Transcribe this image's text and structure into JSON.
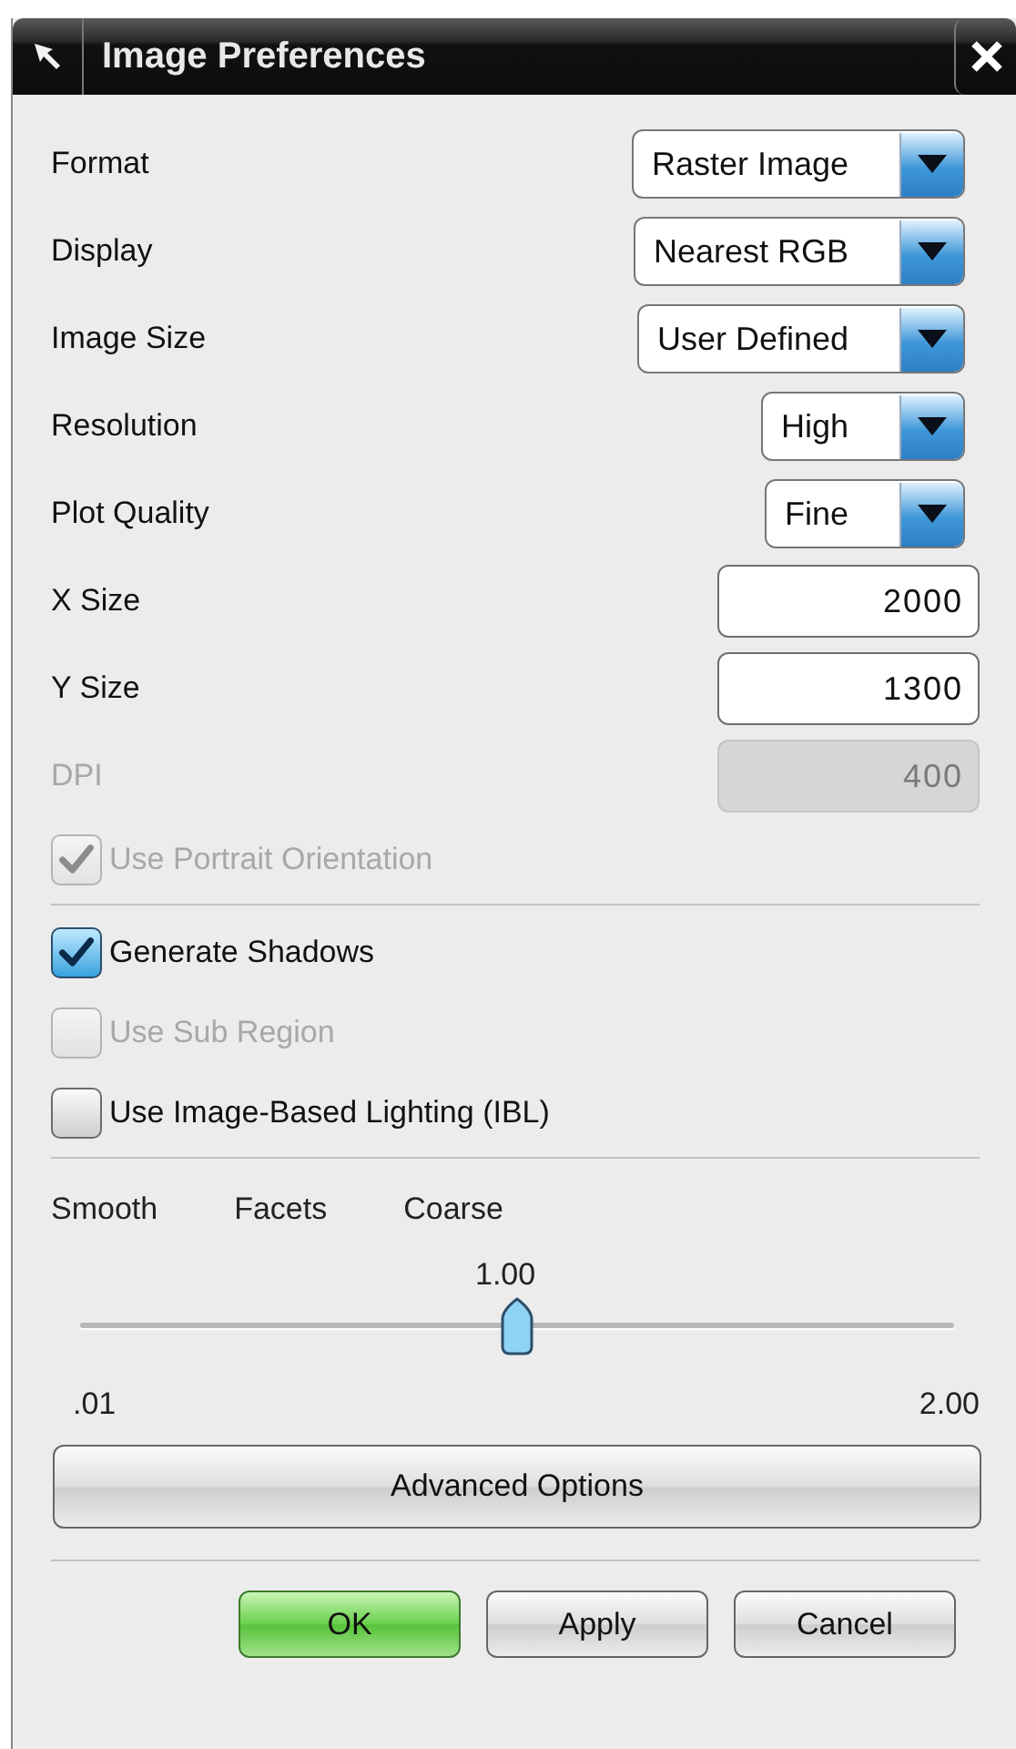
{
  "window": {
    "title": "Image Preferences"
  },
  "form_rows": [
    {
      "kind": "dropdown",
      "label": "Format",
      "value": "Raster Image"
    },
    {
      "kind": "dropdown",
      "label": "Display",
      "value": "Nearest RGB"
    },
    {
      "kind": "dropdown",
      "label": "Image Size",
      "value": "User Defined"
    },
    {
      "kind": "dropdown",
      "label": "Resolution",
      "value": "High"
    },
    {
      "kind": "dropdown",
      "label": "Plot Quality",
      "value": "Fine"
    },
    {
      "kind": "field",
      "label": "X Size",
      "value": "2000",
      "disabled": false
    },
    {
      "kind": "field",
      "label": "Y Size",
      "value": "1300",
      "disabled": false
    },
    {
      "kind": "field",
      "label": "DPI",
      "value": "400",
      "disabled": true
    },
    {
      "kind": "checkbox",
      "label": "Use Portrait Orientation",
      "checked": true,
      "disabled": true
    }
  ],
  "render_options": [
    {
      "label": "Generate Shadows",
      "checked": true,
      "disabled": false
    },
    {
      "label": "Use Sub Region",
      "checked": false,
      "disabled": true
    },
    {
      "label": "Use Image-Based Lighting (IBL)",
      "checked": false,
      "disabled": false
    }
  ],
  "facets_slider": {
    "scale_labels": [
      "Smooth",
      "Facets",
      "Coarse"
    ],
    "reading": "1.00",
    "level": 0.5,
    "min_label": ".01",
    "max_label": "2.00"
  },
  "advanced_button": "Advanced Options",
  "buttons": [
    {
      "label": "OK",
      "default": true
    },
    {
      "label": "Apply",
      "default": false
    },
    {
      "label": "Cancel",
      "default": false
    }
  ]
}
